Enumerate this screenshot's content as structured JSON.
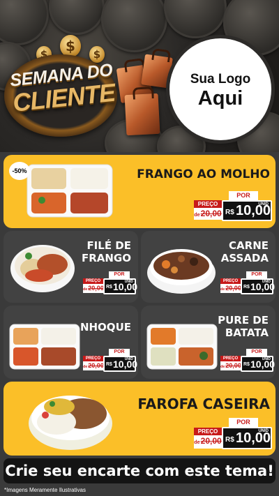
{
  "hero": {
    "title_line1": "SEMANA DO",
    "title_line2": "CLIENTE",
    "logo_line1": "Sua Logo",
    "logo_line2": "Aqui"
  },
  "discount_badge": "-50%",
  "price_labels": {
    "old_label": "PREÇO",
    "de": "de",
    "por": "POR",
    "currency": "R$",
    "unit": "UNID"
  },
  "items": [
    {
      "name": "FRANGO AO MOLHO",
      "old_price": "20,00",
      "price": "10,00"
    },
    {
      "name_line1": "FILÉ DE",
      "name_line2": "FRANGO",
      "old_price": "20,00",
      "price": "10,00"
    },
    {
      "name_line1": "CARNE",
      "name_line2": "ASSADA",
      "old_price": "20,00",
      "price": "10,00"
    },
    {
      "name": "NHOQUE",
      "old_price": "20,00",
      "price": "10,00"
    },
    {
      "name_line1": "PURE DE",
      "name_line2": "BATATA",
      "old_price": "20,00",
      "price": "10,00"
    },
    {
      "name": "FAROFA CASEIRA",
      "old_price": "20,00",
      "price": "10,00"
    }
  ],
  "cta": "Crie seu encarte com este tema!",
  "disclaimer": "*Imagens Meramente Ilustrativas",
  "colors": {
    "yellow": "#fbbf28",
    "dark_card": "#424242",
    "red": "#c71a1a",
    "background": "#3a3a3a"
  }
}
